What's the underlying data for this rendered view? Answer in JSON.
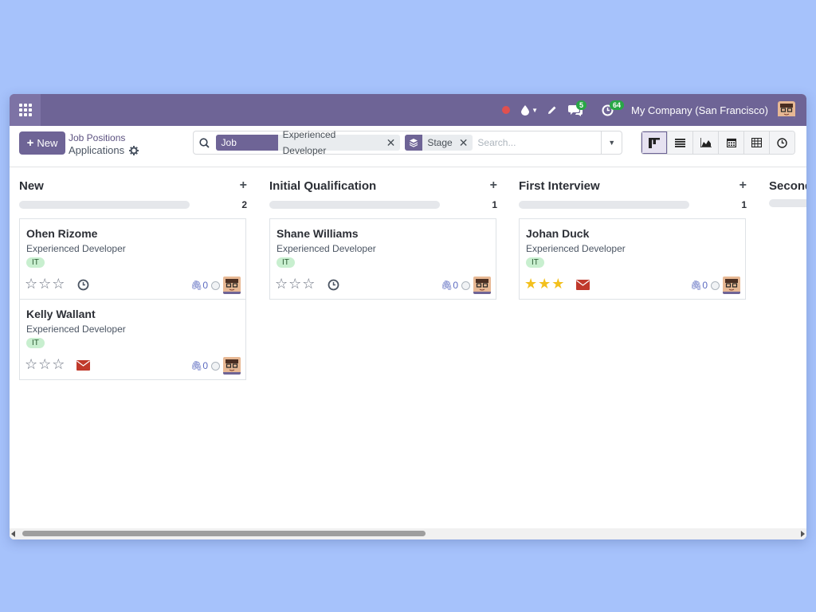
{
  "topbar": {
    "chat_badge": "5",
    "activity_badge": "64",
    "company": "My Company (San Francisco)"
  },
  "control": {
    "new_label": "New",
    "breadcrumb_parent": "Job Positions",
    "breadcrumb_current": "Applications",
    "facets": [
      {
        "label": "Job Position",
        "value": "Experienced Developer"
      },
      {
        "value": "Stage"
      }
    ],
    "search_placeholder": "Search..."
  },
  "columns": [
    {
      "title": "New",
      "count": "2",
      "cards": [
        {
          "name": "Ohen Rizome",
          "job": "Experienced Developer",
          "tag": "IT",
          "stars": 0,
          "activity": "clock",
          "attachments": "0"
        },
        {
          "name": "Kelly Wallant",
          "job": "Experienced Developer",
          "tag": "IT",
          "stars": 0,
          "activity": "envelope",
          "attachments": "0"
        }
      ]
    },
    {
      "title": "Initial Qualification",
      "count": "1",
      "cards": [
        {
          "name": "Shane Williams",
          "job": "Experienced Developer",
          "tag": "IT",
          "stars": 0,
          "activity": "clock",
          "attachments": "0"
        }
      ]
    },
    {
      "title": "First Interview",
      "count": "1",
      "cards": [
        {
          "name": "Johan Duck",
          "job": "Experienced Developer",
          "tag": "IT",
          "stars": 3,
          "activity": "envelope",
          "attachments": "0"
        }
      ]
    },
    {
      "title": "Second Interview",
      "count": "",
      "cards": []
    }
  ],
  "colors": {
    "brand": "#6e6496",
    "tag_bg": "#c8efcf",
    "star_on": "#f3c01d",
    "envelope": "#c0392b"
  },
  "icons": [
    "apps-grid-icon",
    "red-dot-icon",
    "drop-icon",
    "pencil-icon",
    "chat-icon",
    "clock-icon",
    "search-icon",
    "layers-icon",
    "kanban-icon",
    "list-icon",
    "graph-icon",
    "calendar-icon",
    "pivot-icon",
    "activity-icon",
    "star-icon",
    "envelope-icon",
    "paperclip-icon"
  ]
}
